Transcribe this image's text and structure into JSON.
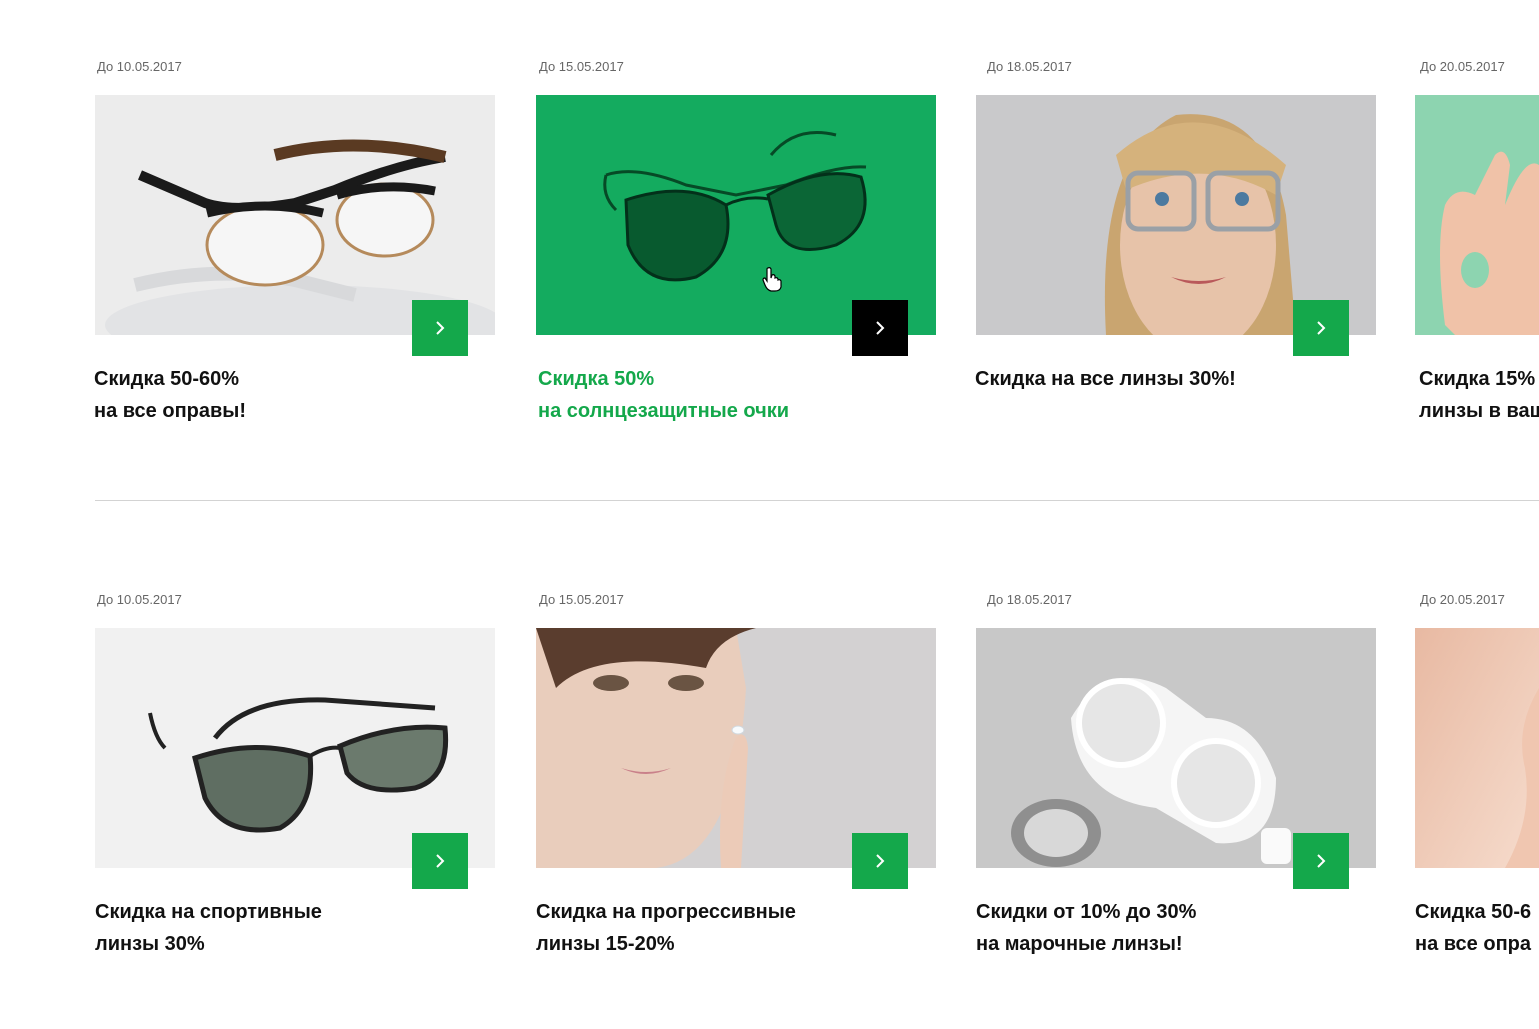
{
  "row1": [
    {
      "date": "До 10.05.2017",
      "title_line1": "Скидка 50-60%",
      "title_line2": "на все оправы!",
      "image": "eyeglasses-clubmaster"
    },
    {
      "date": "До 15.05.2017",
      "title_line1": "Скидка 50%",
      "title_line2": "на солнцезащитные очки",
      "image": "aviator-sunglasses-green"
    },
    {
      "date": "До 18.05.2017",
      "title_line1": "Скидка на все линзы 30%!",
      "title_line2": "",
      "image": "woman-with-glasses"
    },
    {
      "date": "До 20.05.2017",
      "title_line1": "Скидка 15%",
      "title_line2": "линзы в ваш",
      "image": "hand-ok-gesture"
    }
  ],
  "row2": [
    {
      "date": "До 10.05.2017",
      "title_line1": "Скидка на спортивные",
      "title_line2": "линзы 30%",
      "image": "sport-sunglasses"
    },
    {
      "date": "До 15.05.2017",
      "title_line1": "Скидка на прогрессивные",
      "title_line2": "линзы 15-20%",
      "image": "woman-contact-lens"
    },
    {
      "date": "До 18.05.2017",
      "title_line1": "Скидки от 10% до 30%",
      "title_line2": "на марочные линзы!",
      "image": "contact-lens-case"
    },
    {
      "date": "До 20.05.2017",
      "title_line1": "Скидка 50-6",
      "title_line2": "на все опра",
      "image": "woman-skin"
    }
  ],
  "colors": {
    "accent": "#14a84b",
    "active_button": "#000000",
    "divider": "#d3d3d3"
  },
  "icons": {
    "arrow": "chevron-right-icon",
    "cursor": "hand-pointer-icon"
  }
}
